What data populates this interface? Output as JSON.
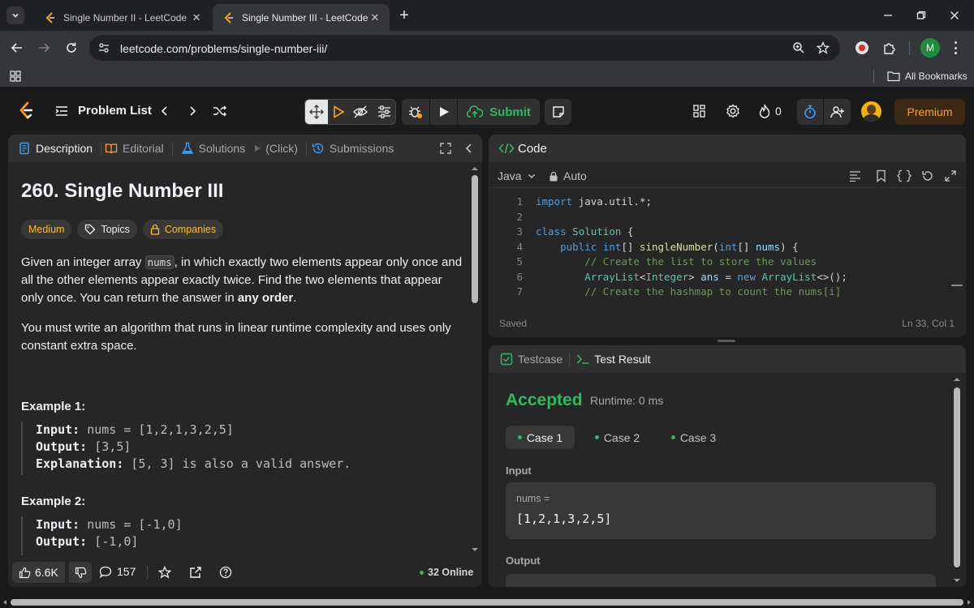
{
  "browser": {
    "tabs": [
      {
        "title": "Single Number II - LeetCode",
        "active": false
      },
      {
        "title": "Single Number III - LeetCode",
        "active": true
      }
    ],
    "url": "leetcode.com/problems/single-number-iii/",
    "bookmarks_label": "All Bookmarks",
    "profile_initial": "M"
  },
  "nav": {
    "problem_list": "Problem List",
    "submit": "Submit",
    "streak_count": "0",
    "premium": "Premium"
  },
  "left": {
    "tabs": {
      "description": "Description",
      "editorial": "Editorial",
      "solutions": "Solutions",
      "click": "(Click)",
      "submissions": "Submissions"
    },
    "title": "260. Single Number III",
    "difficulty": "Medium",
    "topics": "Topics",
    "companies": "Companies",
    "para1_a": "Given an integer array ",
    "para1_code": "nums",
    "para1_b": ", in which exactly two elements appear only once and all the other elements appear exactly twice. Find the two elements that appear only once. You can return the answer in ",
    "para1_bold": "any order",
    "para1_end": ".",
    "para2": "You must write an algorithm that runs in linear runtime complexity and uses only constant extra space.",
    "example1": {
      "heading": "Example 1:",
      "input_label": "Input:",
      "input_value": "nums = [1,2,1,3,2,5]",
      "output_label": "Output:",
      "output_value": "[3,5]",
      "explanation_label": "Explanation:",
      "explanation_value": " [5, 3] is also a valid answer."
    },
    "example2": {
      "heading": "Example 2:",
      "input_label": "Input:",
      "input_value": "nums = [-1,0]",
      "output_label": "Output:",
      "output_value": "[-1,0]"
    },
    "footer": {
      "likes": "6.6K",
      "comments": "157",
      "online": "32 Online"
    }
  },
  "code": {
    "header": "Code",
    "language": "Java",
    "mode": "Auto",
    "lines": [
      {
        "n": "1",
        "text": "import java.util.*;"
      },
      {
        "n": "2",
        "text": ""
      },
      {
        "n": "3",
        "text": "class Solution {"
      },
      {
        "n": "4",
        "text": "    public int[] singleNumber(int[] nums) {"
      },
      {
        "n": "5",
        "text": "        // Create the list to store the values"
      },
      {
        "n": "6",
        "text": "        ArrayList<Integer> ans = new ArrayList<>();"
      },
      {
        "n": "7",
        "text": "        // Create the hashmap to count the nums[i]"
      }
    ],
    "status": "Saved",
    "cursor": "Ln 33, Col 1"
  },
  "result": {
    "testcase_tab": "Testcase",
    "result_tab": "Test Result",
    "status": "Accepted",
    "runtime": "Runtime: 0 ms",
    "cases": [
      "Case 1",
      "Case 2",
      "Case 3"
    ],
    "input_label": "Input",
    "var_name": "nums =",
    "var_value": "[1,2,1,3,2,5]",
    "output_label": "Output"
  },
  "colors": {
    "accepted": "#2cbb5d",
    "medium": "#ffc01e",
    "premium_text": "#ffa116"
  }
}
